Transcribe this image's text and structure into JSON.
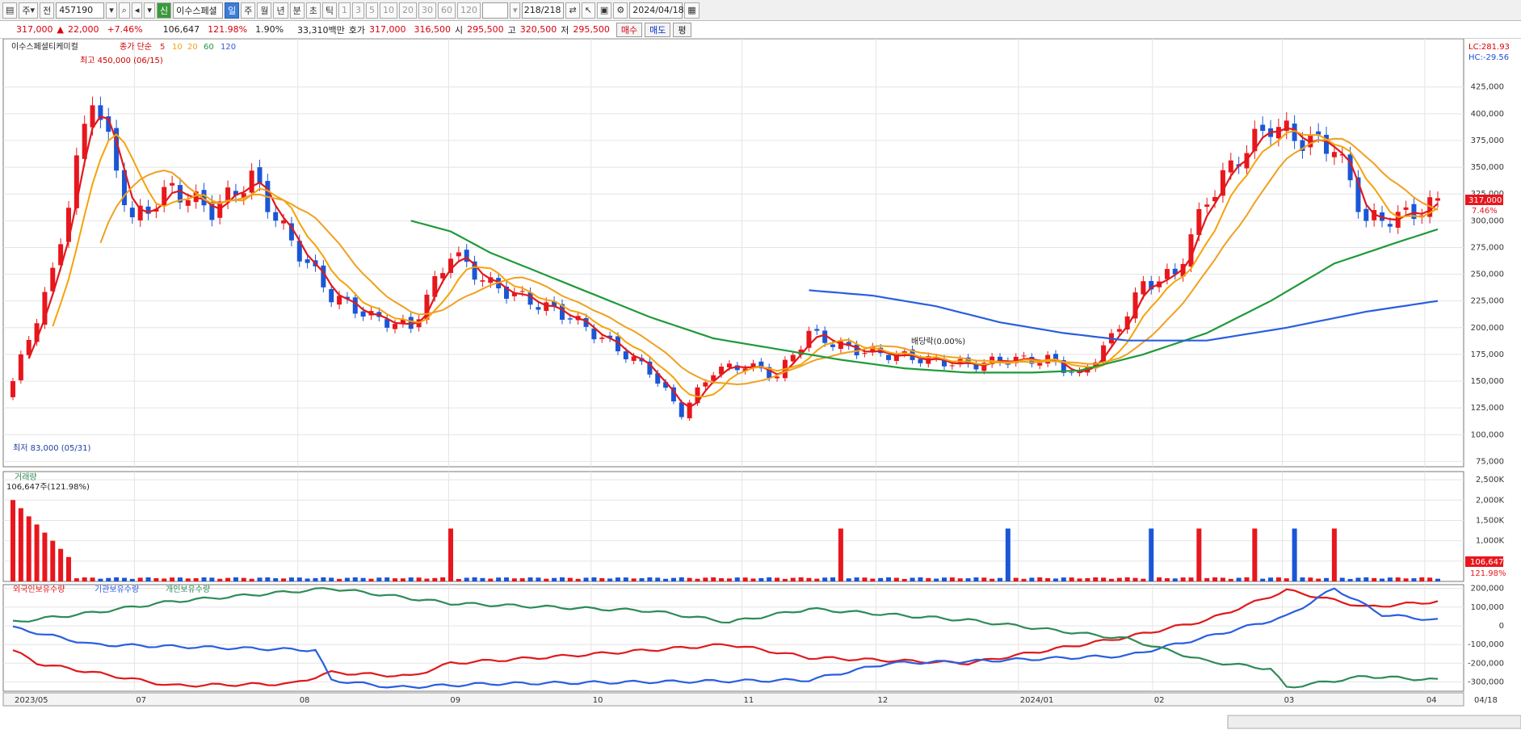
{
  "toolbar": {
    "stock_type": "주",
    "kind": "전",
    "code": "457190",
    "name_badge": "신",
    "name": "이수스페셜",
    "periods": [
      "일",
      "주",
      "월",
      "년",
      "분",
      "초",
      "틱"
    ],
    "active_period": "일",
    "counts": [
      "1",
      "3",
      "5",
      "10",
      "20",
      "30",
      "60",
      "120"
    ],
    "range": "218",
    "range_total": "/218",
    "date": "2024/04/18"
  },
  "quote": {
    "price": "317,000",
    "arrow": "▲",
    "change": "22,000",
    "rate": "+7.46%",
    "volume": "106,647",
    "vol_rate": "121.98%",
    "turnover": "1.90%",
    "amount": "33,310백만",
    "bid_label": "호가",
    "bid1": "317,000",
    "bid2": "316,500",
    "open_label": "시",
    "open": "295,500",
    "high_label": "고",
    "high": "320,500",
    "low_label": "저",
    "low": "295,500",
    "buy": "매수",
    "sell": "매도",
    "eval": "평"
  },
  "price_panel": {
    "title": "이수스페셜티케미컬",
    "ma_label": "종가 단순",
    "ma_periods": [
      "5",
      "10",
      "20",
      "60",
      "120"
    ],
    "high_annot": "최고 450,000 (06/15)",
    "low_annot": "최저 83,000 (05/31)",
    "dividend_annot": "배당락(0.00%)",
    "lc": "LC:281.93",
    "hc": "HC:-29.56",
    "last_price": "317,000",
    "last_rate": "7.46%",
    "y_ticks": [
      "425,000",
      "400,000",
      "375,000",
      "350,000",
      "325,000",
      "300,000",
      "275,000",
      "250,000",
      "225,000",
      "200,000",
      "175,000",
      "150,000",
      "125,000",
      "100,000",
      "75,000"
    ]
  },
  "volume_panel": {
    "title": "거래량",
    "info": "106,647주(121.98%)",
    "y_ticks": [
      "2,500K",
      "2,000K",
      "1,500K",
      "1,000K",
      "500,000"
    ],
    "last_value": "106,647",
    "last_rate": "121.98%"
  },
  "holdings_panel": {
    "legend": [
      "외국인보유수량",
      "기관보유수량",
      "개인보유수량"
    ],
    "y_ticks": [
      "200,000",
      "100,000",
      "0",
      "-100,000",
      "-200,000",
      "-300,000"
    ]
  },
  "x_axis": {
    "labels": [
      "2023/05",
      "07",
      "08",
      "09",
      "10",
      "11",
      "12",
      "2024/01",
      "02",
      "03",
      "04",
      "04/18"
    ]
  },
  "colors": {
    "up": "#e8161d",
    "down": "#1a56d6",
    "ma5": "#e0191c",
    "ma10": "#f5a30a",
    "ma20": "#f0a020",
    "ma60": "#1f9a3a",
    "ma120": "#2a5ee0",
    "foreign": "#e0191c",
    "inst": "#2a5ee0",
    "indiv": "#2e8b57"
  },
  "chart_data": [
    {
      "type": "candlestick",
      "title": "이수스페셜티케미컬",
      "x_labels": [
        "2023/05",
        "07",
        "08",
        "09",
        "10",
        "11",
        "12",
        "2024/01",
        "02",
        "03",
        "04"
      ],
      "close_path": [
        [
          0,
          150000
        ],
        [
          5,
          250000
        ],
        [
          10,
          420000
        ],
        [
          15,
          300000
        ],
        [
          20,
          330000
        ],
        [
          25,
          310000
        ],
        [
          30,
          340000
        ],
        [
          35,
          280000
        ],
        [
          40,
          230000
        ],
        [
          45,
          210000
        ],
        [
          50,
          200000
        ],
        [
          55,
          270000
        ],
        [
          60,
          240000
        ],
        [
          65,
          225000
        ],
        [
          70,
          210000
        ],
        [
          75,
          185000
        ],
        [
          80,
          160000
        ],
        [
          84,
          120000
        ],
        [
          88,
          160000
        ],
        [
          92,
          165000
        ],
        [
          96,
          155000
        ],
        [
          100,
          195000
        ],
        [
          105,
          180000
        ],
        [
          110,
          175000
        ],
        [
          115,
          170000
        ],
        [
          120,
          165000
        ],
        [
          125,
          170000
        ],
        [
          130,
          170000
        ],
        [
          134,
          155000
        ],
        [
          138,
          190000
        ],
        [
          142,
          240000
        ],
        [
          146,
          250000
        ],
        [
          150,
          320000
        ],
        [
          154,
          360000
        ],
        [
          158,
          390000
        ],
        [
          162,
          375000
        ],
        [
          166,
          370000
        ],
        [
          170,
          300000
        ],
        [
          175,
          305000
        ],
        [
          179,
          317000
        ]
      ],
      "ma60": [
        [
          50,
          300000
        ],
        [
          55,
          290000
        ],
        [
          60,
          270000
        ],
        [
          70,
          240000
        ],
        [
          80,
          210000
        ],
        [
          88,
          190000
        ],
        [
          96,
          180000
        ],
        [
          104,
          170000
        ],
        [
          112,
          162000
        ],
        [
          120,
          158000
        ],
        [
          128,
          158000
        ],
        [
          134,
          160000
        ],
        [
          142,
          175000
        ],
        [
          150,
          195000
        ],
        [
          158,
          225000
        ],
        [
          166,
          260000
        ],
        [
          174,
          280000
        ],
        [
          179,
          292000
        ]
      ],
      "ma120": [
        [
          100,
          235000
        ],
        [
          108,
          230000
        ],
        [
          116,
          220000
        ],
        [
          124,
          205000
        ],
        [
          132,
          195000
        ],
        [
          140,
          188000
        ],
        [
          150,
          188000
        ],
        [
          160,
          200000
        ],
        [
          170,
          215000
        ],
        [
          179,
          225000
        ]
      ],
      "last": {
        "price": 317000,
        "rate": "7.46%"
      },
      "ylim": [
        70000,
        455000
      ]
    },
    {
      "type": "bar",
      "title": "거래량",
      "ylim": [
        0,
        2700000
      ]
    },
    {
      "type": "line",
      "series": [
        {
          "name": "외국인보유수량",
          "values_path": [
            [
              0,
              -130000
            ],
            [
              3,
              -200000
            ],
            [
              20,
              -320000
            ],
            [
              35,
              -310000
            ],
            [
              40,
              -250000
            ],
            [
              50,
              -270000
            ],
            [
              55,
              -200000
            ],
            [
              70,
              -160000
            ],
            [
              90,
              -100000
            ],
            [
              100,
              -170000
            ],
            [
              120,
              -200000
            ],
            [
              140,
              -60000
            ],
            [
              150,
              30000
            ],
            [
              160,
              190000
            ],
            [
              170,
              100000
            ],
            [
              179,
              130000
            ]
          ]
        },
        {
          "name": "기관보유수량",
          "values_path": [
            [
              0,
              -10000
            ],
            [
              10,
              -100000
            ],
            [
              38,
              -130000
            ],
            [
              40,
              -290000
            ],
            [
              48,
              -330000
            ],
            [
              60,
              -310000
            ],
            [
              100,
              -290000
            ],
            [
              110,
              -200000
            ],
            [
              120,
              -190000
            ],
            [
              140,
              -160000
            ],
            [
              150,
              -60000
            ],
            [
              160,
              50000
            ],
            [
              166,
              200000
            ],
            [
              172,
              60000
            ],
            [
              179,
              30000
            ]
          ]
        },
        {
          "name": "개인보유수량",
          "values_path": [
            [
              0,
              20000
            ],
            [
              10,
              70000
            ],
            [
              20,
              130000
            ],
            [
              40,
              200000
            ],
            [
              55,
              120000
            ],
            [
              80,
              80000
            ],
            [
              90,
              20000
            ],
            [
              100,
              90000
            ],
            [
              120,
              30000
            ],
            [
              140,
              -70000
            ],
            [
              150,
              -190000
            ],
            [
              158,
              -230000
            ],
            [
              160,
              -330000
            ],
            [
              170,
              -270000
            ],
            [
              179,
              -290000
            ]
          ]
        }
      ],
      "ylim": [
        -350000,
        220000
      ]
    }
  ]
}
